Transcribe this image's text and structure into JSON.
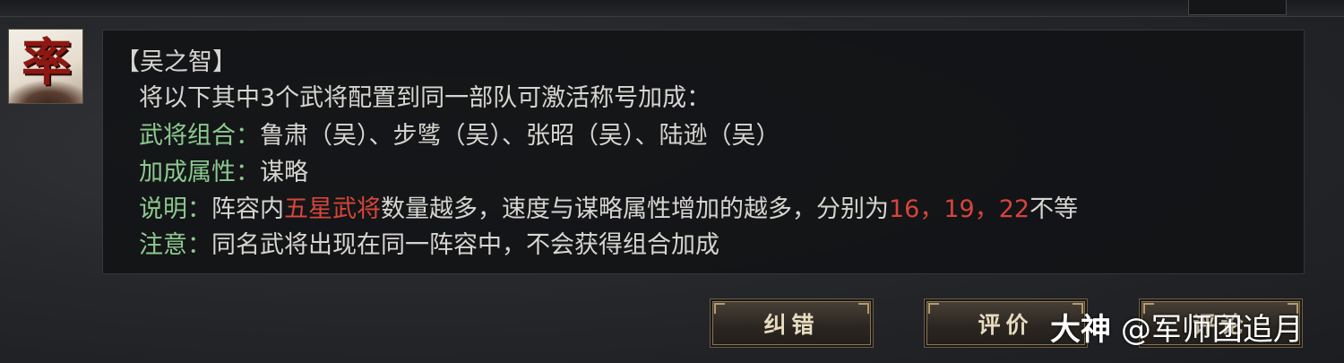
{
  "tooltip": {
    "title": "【吴之智】",
    "intro": "将以下其中3个武将配置到同一部队可激活称号加成：",
    "combo_label": "武将组合：",
    "combo_value": "鲁肃（吴）、步骘（吴）、张昭（吴）、陆逊（吴）",
    "bonus_label": "加成属性：",
    "bonus_value": "谋略",
    "desc_label": "说明：",
    "desc_pre": "阵容内",
    "desc_highlight": "五星武将",
    "desc_mid": "数量越多，速度与谋略属性增加的越多，分别为",
    "desc_values": "16，19，22",
    "desc_post": "不等",
    "note_label": "注意：",
    "note_value": "同名武将出现在同一阵容中，不会获得组合加成"
  },
  "avatar": {
    "glyph": "率",
    "icon": "general-portrait-icon"
  },
  "buttons": {
    "report": "纠错",
    "review": "评价",
    "third": "评论"
  },
  "watermark": {
    "brand": "大神",
    "handle": "@军师团追月"
  },
  "colors": {
    "label_green": "#8bc98e",
    "highlight_red": "#d6453a",
    "text": "#d7d5d0"
  }
}
